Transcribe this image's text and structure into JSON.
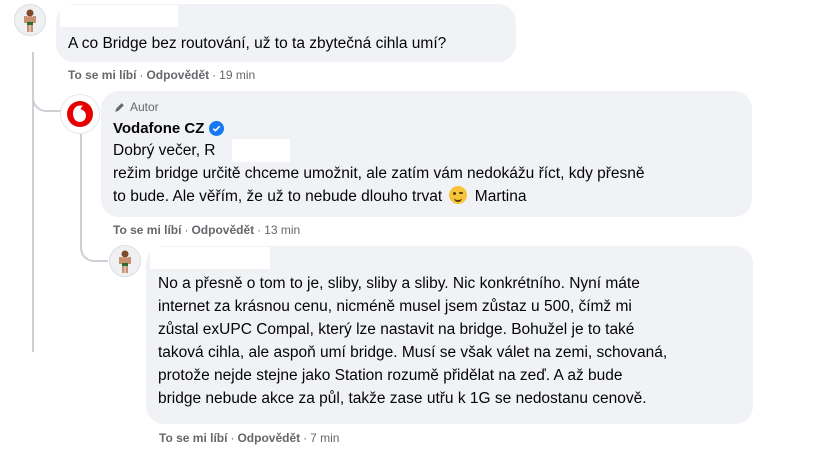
{
  "comment1": {
    "text": "A co Bridge bez routování, už to ta zbytečná cihla umí?",
    "like": "To se mi líbí",
    "reply": "Odpovědět",
    "time": "19 min"
  },
  "reply1": {
    "author_tag": "Autor",
    "author": "Vodafone CZ",
    "lines": [
      "Dobrý večer, R",
      "režim bridge určitě chceme umožnit, ale zatím vám nedokážu říct, kdy přesně",
      "to bude. Ale věřím, že už to nebude dlouho trvat",
      "Martina"
    ],
    "like": "To se mi líbí",
    "reply": "Odpovědět",
    "time": "13 min",
    "brand_color": "#e60000"
  },
  "reply2": {
    "lines": [
      "No a přesně o tom to je, sliby, sliby a sliby. Nic konkrétního. Nyní máte",
      "internet za krásnou cenu, nicméně musel jsem zůstaz u 500, čímž mi",
      "zůstal exUPC Compal, který lze nastavit na bridge. Bohužel je to také",
      "taková cihla, ale aspoň umí bridge. Musí se však válet na zemi, schovaná,",
      "protože nejde stejne jako Station rozumě přidělat na zeď. A až bude",
      "bridge nebude akce za půl, takže zase utřu k 1G se nedostanu cenově."
    ],
    "like": "To se mi líbí",
    "reply": "Odpovědět",
    "time": "7 min"
  },
  "separator": "·",
  "colors": {
    "bubble": "#f0f2f5",
    "meta": "#65676b",
    "verified": "#1877f2",
    "thread_line": "#ccd0d5"
  }
}
